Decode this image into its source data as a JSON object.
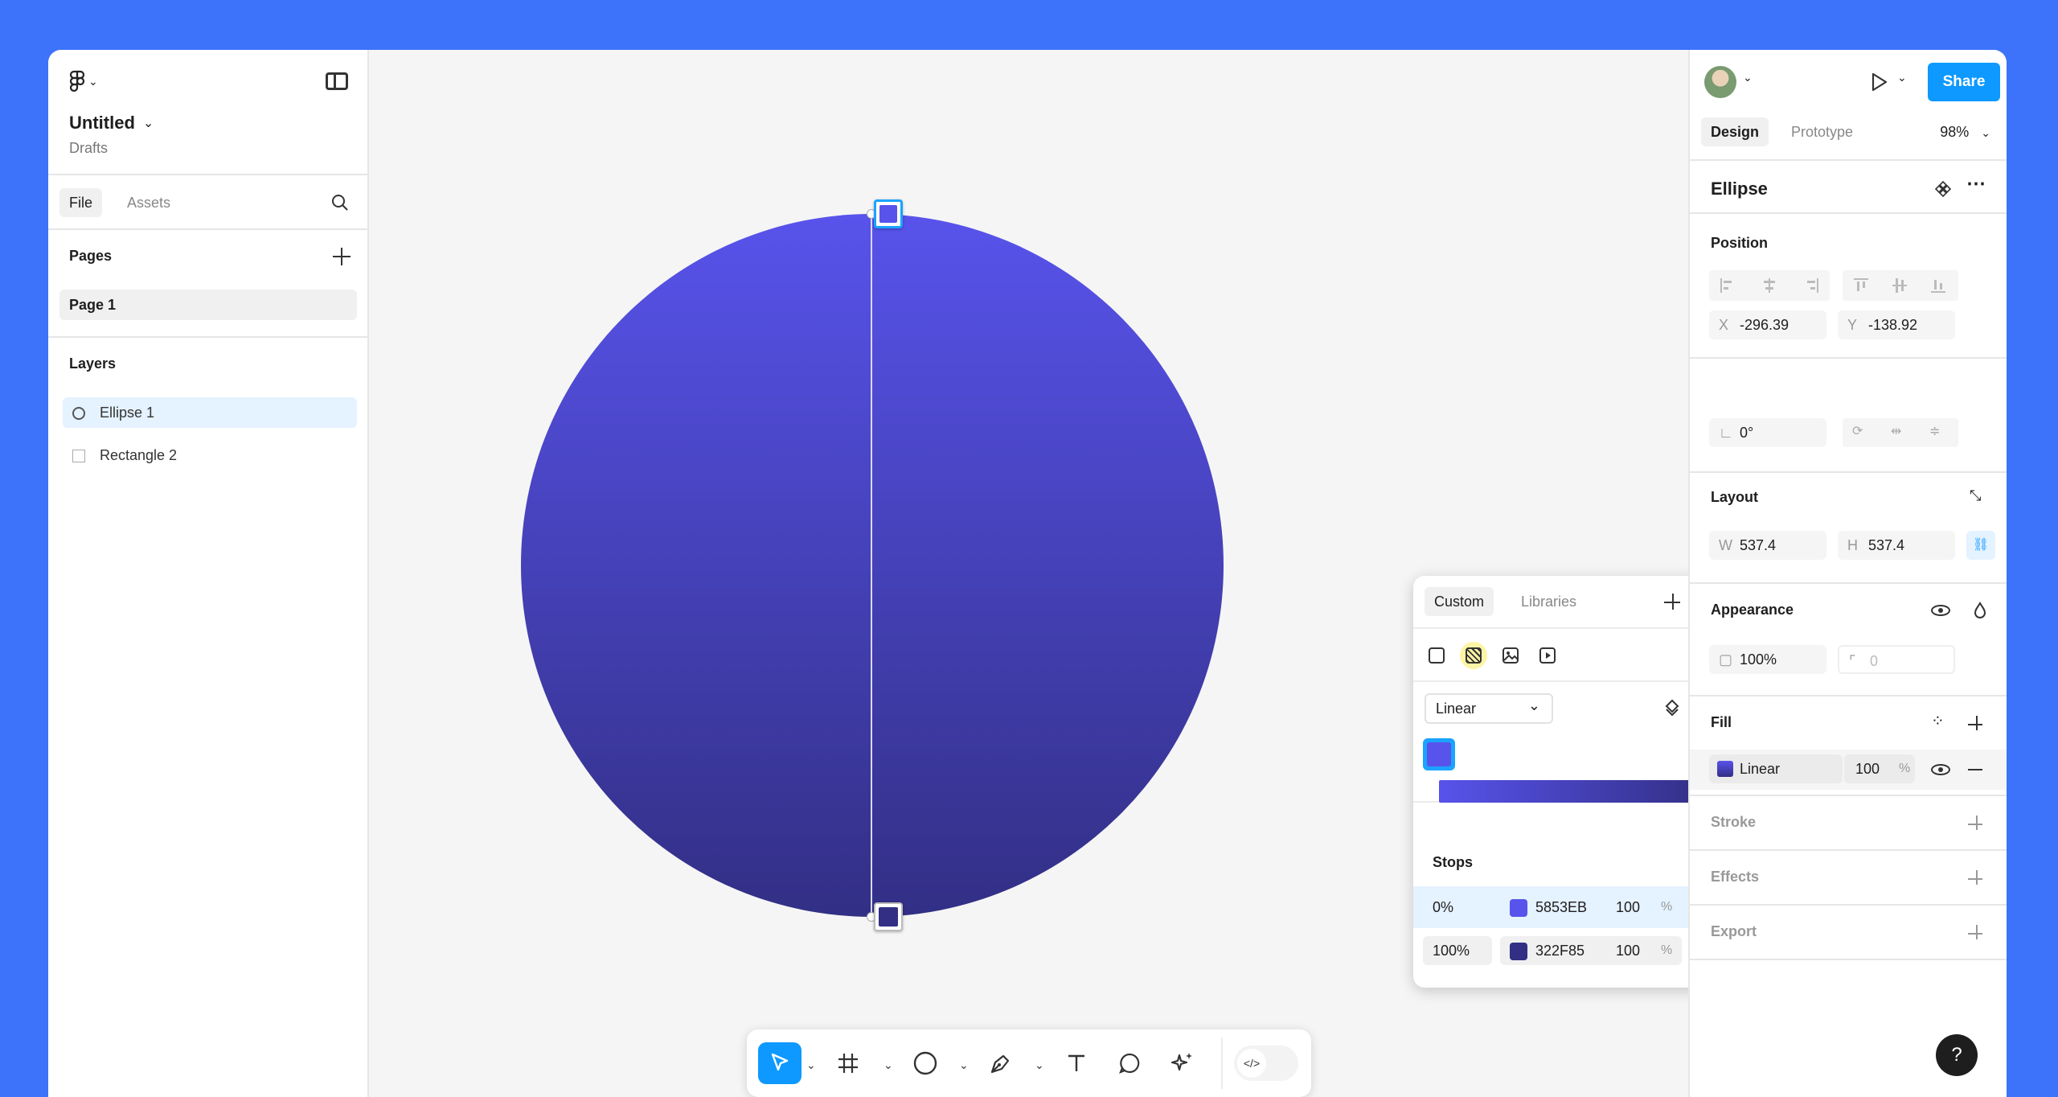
{
  "file": {
    "title": "Untitled",
    "location": "Drafts"
  },
  "left_tabs": {
    "file": "File",
    "assets": "Assets"
  },
  "pages": {
    "heading": "Pages",
    "items": [
      "Page 1"
    ]
  },
  "layers": {
    "heading": "Layers",
    "items": [
      {
        "label": "Ellipse 1",
        "icon": "ellipse-icon"
      },
      {
        "label": "Rectangle 2",
        "icon": "rectangle-icon"
      }
    ]
  },
  "picker": {
    "tabs": {
      "custom": "Custom",
      "libraries": "Libraries"
    },
    "gradient_type": "Linear",
    "stops_heading": "Stops",
    "stops": [
      {
        "position": "0%",
        "hex": "5853EB",
        "opacity": "100",
        "unit": "%",
        "color": "#5853EB"
      },
      {
        "position": "100%",
        "hex": "322F85",
        "opacity": "100",
        "unit": "%",
        "color": "#322F85"
      }
    ]
  },
  "right": {
    "share": "Share",
    "tabs": {
      "design": "Design",
      "prototype": "Prototype"
    },
    "zoom": "98%",
    "selection_name": "Ellipse",
    "position": {
      "heading": "Position",
      "x_label": "X",
      "x": "-296.39",
      "y_label": "Y",
      "y": "-138.92",
      "rotation": "0°"
    },
    "layout": {
      "heading": "Layout",
      "w_label": "W",
      "w": "537.4",
      "h_label": "H",
      "h": "537.4"
    },
    "appearance": {
      "heading": "Appearance",
      "opacity": "100%",
      "radius": "0"
    },
    "fill": {
      "heading": "Fill",
      "type": "Linear",
      "opacity": "100",
      "unit": "%"
    },
    "stroke": "Stroke",
    "effects": "Effects",
    "export": "Export"
  },
  "help": "?",
  "colors": {
    "accent": "#0d99ff",
    "background": "#3c73fa",
    "stop_start": "#5853EB",
    "stop_end": "#322F85"
  }
}
